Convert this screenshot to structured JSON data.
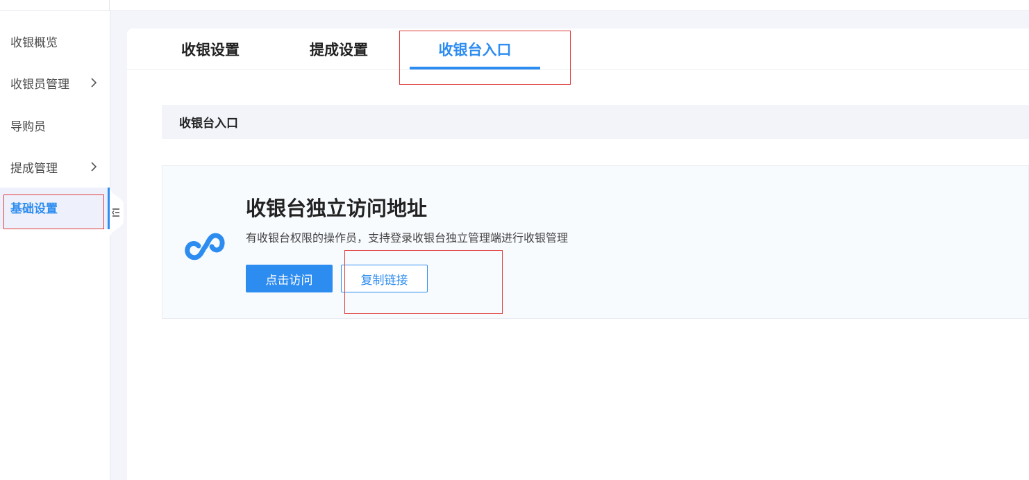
{
  "sidebar": {
    "items": [
      {
        "label": "收银概览"
      },
      {
        "label": "收银员管理",
        "has_children": true
      },
      {
        "label": "导购员"
      },
      {
        "label": "提成管理",
        "has_children": true
      },
      {
        "label": "基础设置",
        "active": true
      }
    ],
    "collapse_icon": "list-collapse-icon"
  },
  "tabs": [
    {
      "label": "收银设置"
    },
    {
      "label": "提成设置"
    },
    {
      "label": "收银台入口",
      "active": true
    }
  ],
  "section": {
    "title": "收银台入口"
  },
  "card": {
    "icon": "link-icon",
    "title": "收银台独立访问地址",
    "description": "有收银台权限的操作员，支持登录收银台独立管理端进行收银管理",
    "visit_label": "点击访问",
    "copy_label": "复制链接"
  },
  "colors": {
    "accent": "#2d8cf0",
    "highlight_box": "#e03a3a",
    "page_bg": "#f3f5fb"
  }
}
